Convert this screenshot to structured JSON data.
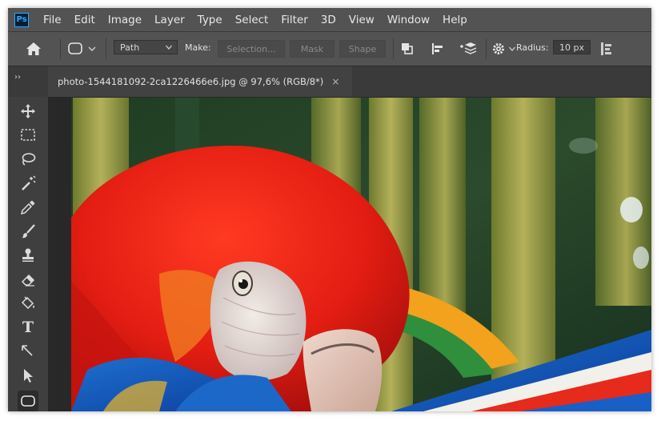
{
  "app": {
    "logo_text": "Ps",
    "accent": "#31a8ff"
  },
  "menu": [
    "File",
    "Edit",
    "Image",
    "Layer",
    "Type",
    "Select",
    "Filter",
    "3D",
    "View",
    "Window",
    "Help"
  ],
  "options": {
    "mode_value": "Path",
    "make_label": "Make:",
    "selection_label": "Selection...",
    "mask_label": "Mask",
    "shape_label": "Shape",
    "radius_label": "Radius:",
    "radius_value": "10 px"
  },
  "document": {
    "tab_title": "photo-1544181092-2ca1226466e6.jpg @ 97,6% (RGB/8*)",
    "close_glyph": "×",
    "collapse_glyph": "››"
  },
  "tools": [
    {
      "name": "move-tool",
      "icon": "move-icon"
    },
    {
      "name": "marquee-tool",
      "icon": "marquee-icon"
    },
    {
      "name": "lasso-tool",
      "icon": "lasso-icon"
    },
    {
      "name": "magic-wand-tool",
      "icon": "magic-wand-icon"
    },
    {
      "name": "eyedropper-tool",
      "icon": "eyedropper-icon"
    },
    {
      "name": "brush-tool",
      "icon": "brush-icon"
    },
    {
      "name": "stamp-tool",
      "icon": "stamp-icon"
    },
    {
      "name": "eraser-tool",
      "icon": "eraser-icon"
    },
    {
      "name": "paint-bucket-tool",
      "icon": "paint-bucket-icon"
    },
    {
      "name": "type-tool",
      "icon": "type-icon",
      "glyph": "T"
    },
    {
      "name": "pen-tool",
      "icon": "pen-icon"
    },
    {
      "name": "path-selection-tool",
      "icon": "direct-select-arrow-icon"
    },
    {
      "name": "rounded-rectangle-tool",
      "icon": "rounded-rectangle-icon",
      "active": true
    }
  ]
}
